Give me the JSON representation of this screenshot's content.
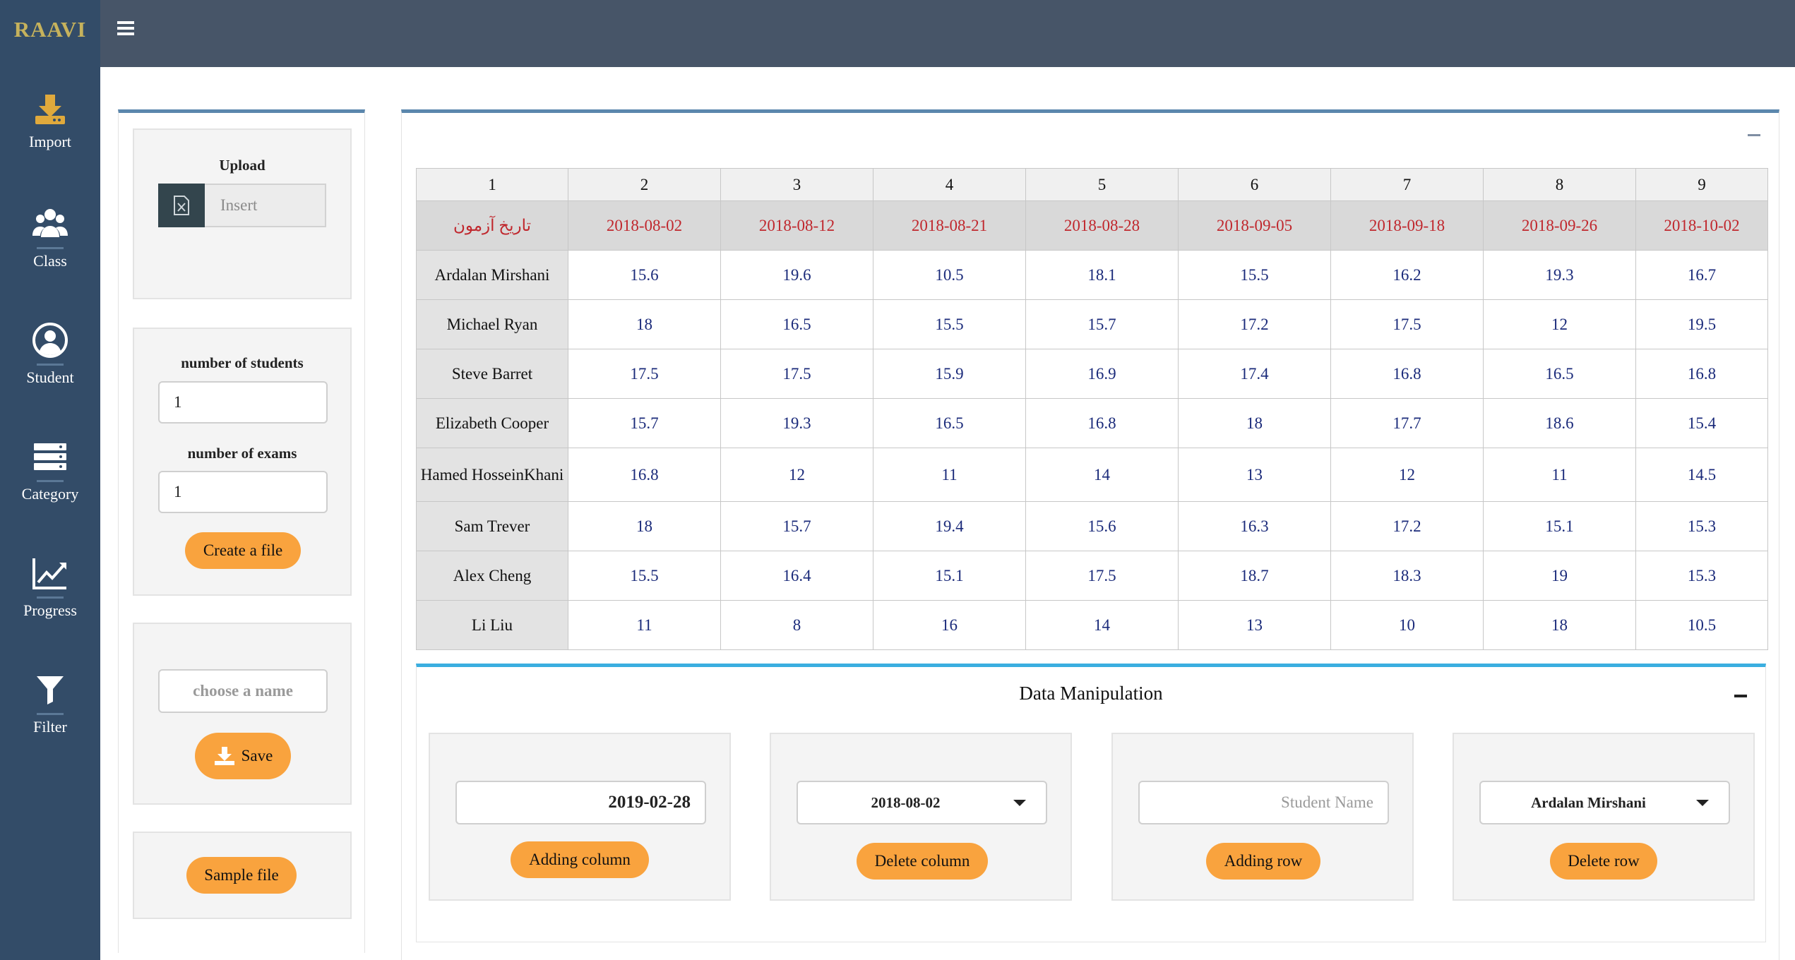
{
  "brand": "RAAVI",
  "sidebar": {
    "items": [
      {
        "label": "Import",
        "icon": "download-icon"
      },
      {
        "label": "Class",
        "icon": "users-icon"
      },
      {
        "label": "Student",
        "icon": "user-circle-icon"
      },
      {
        "label": "Category",
        "icon": "server-icon"
      },
      {
        "label": "Progress",
        "icon": "chart-line-icon"
      },
      {
        "label": "Filter",
        "icon": "filter-icon"
      }
    ]
  },
  "upload": {
    "label": "Upload",
    "button_label": "Insert"
  },
  "create": {
    "students_label": "number of students",
    "students_value": "1",
    "exams_label": "number of exams",
    "exams_value": "1",
    "button_label": "Create a file"
  },
  "save": {
    "name_placeholder": "choose a name",
    "button_label": "Save"
  },
  "sample": {
    "button_label": "Sample file"
  },
  "table": {
    "column_numbers": [
      "1",
      "2",
      "3",
      "4",
      "5",
      "6",
      "7",
      "8",
      "9"
    ],
    "date_row_label": "تاریخ آزمون",
    "dates": [
      "2018-08-02",
      "2018-08-12",
      "2018-08-21",
      "2018-08-28",
      "2018-09-05",
      "2018-09-18",
      "2018-09-26",
      "2018-10-02"
    ],
    "rows": [
      {
        "name": "Ardalan Mirshani",
        "values": [
          "15.6",
          "19.6",
          "10.5",
          "18.1",
          "15.5",
          "16.2",
          "19.3",
          "16.7"
        ]
      },
      {
        "name": "Michael Ryan",
        "values": [
          "18",
          "16.5",
          "15.5",
          "15.7",
          "17.2",
          "17.5",
          "12",
          "19.5"
        ]
      },
      {
        "name": "Steve Barret",
        "values": [
          "17.5",
          "17.5",
          "15.9",
          "16.9",
          "17.4",
          "16.8",
          "16.5",
          "16.8"
        ]
      },
      {
        "name": "Elizabeth Cooper",
        "values": [
          "15.7",
          "19.3",
          "16.5",
          "16.8",
          "18",
          "17.7",
          "18.6",
          "15.4"
        ]
      },
      {
        "name": "Hamed HosseinKhani",
        "values": [
          "16.8",
          "12",
          "11",
          "14",
          "13",
          "12",
          "11",
          "14.5"
        ]
      },
      {
        "name": "Sam Trever",
        "values": [
          "18",
          "15.7",
          "19.4",
          "15.6",
          "16.3",
          "17.2",
          "15.1",
          "15.3"
        ]
      },
      {
        "name": "Alex Cheng",
        "values": [
          "15.5",
          "16.4",
          "15.1",
          "17.5",
          "18.7",
          "18.3",
          "19",
          "15.3"
        ]
      },
      {
        "name": "Li Liu",
        "values": [
          "11",
          "8",
          "16",
          "14",
          "13",
          "10",
          "18",
          "10.5"
        ]
      }
    ]
  },
  "data_manipulation": {
    "title": "Data Manipulation",
    "add_column": {
      "value": "2019-02-28",
      "button_label": "Adding column"
    },
    "delete_column": {
      "selected": "2018-08-02",
      "button_label": "Delete column"
    },
    "add_row": {
      "placeholder": "Student Name",
      "button_label": "Adding row"
    },
    "delete_row": {
      "selected": "Ardalan Mirshani",
      "button_label": "Delete row"
    }
  },
  "colors": {
    "sidebar_bg": "#334c68",
    "topbar_bg": "#475568",
    "brand": "#c6b25c",
    "accent_orange": "#f9a33e",
    "date_text": "#c0272d",
    "value_text": "#1a2a7a",
    "panel_border": "#5b87ad",
    "dm_border": "#3aaee0"
  }
}
